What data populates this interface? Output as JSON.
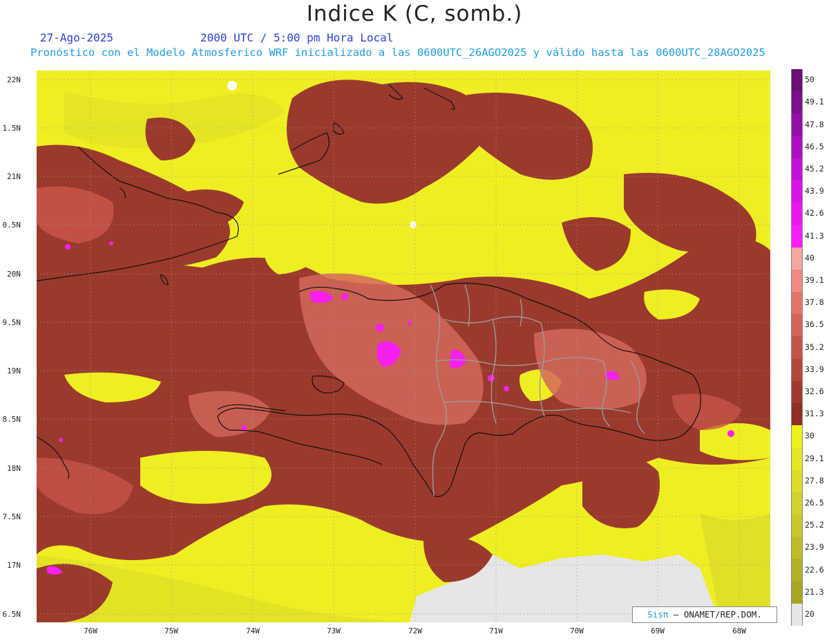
{
  "header": {
    "title": "Indice K (C, somb.)",
    "date": "27-Ago-2025",
    "time": "2000 UTC / 5:00 pm Hora Local",
    "model_info": "Pronóstico con el Modelo Atmosferico WRF inicializado a las 0600UTC_26AGO2025 y válido hasta las  0600UTC_28AGO2025"
  },
  "axes": {
    "lat_labels": [
      "22N",
      "1.5N",
      "21N",
      "0.5N",
      "20N",
      "9.5N",
      "19N",
      "8.5N",
      "18N",
      "7.5N",
      "17N",
      "6.5N"
    ],
    "lon_labels": [
      "76W",
      "75W",
      "74W",
      "73W",
      "72W",
      "71W",
      "70W",
      "69W",
      "68W"
    ]
  },
  "colorbar": {
    "labels": [
      "50",
      "49.1",
      "47.8",
      "46.5",
      "45.2",
      "43.9",
      "42.6",
      "41.3",
      "40",
      "39.1",
      "37.8",
      "36.5",
      "35.2",
      "33.9",
      "32.6",
      "31.3",
      "30",
      "29.1",
      "27.8",
      "26.5",
      "25.2",
      "23.9",
      "22.6",
      "21.3",
      "20"
    ],
    "colors": [
      "#6a0f78",
      "#7d0f8e",
      "#940fa8",
      "#ac10c2",
      "#c312d8",
      "#d915e6",
      "#ea18ef",
      "#f81ef8",
      "#f7a5a0",
      "#f08a82",
      "#e47468",
      "#d66457",
      "#c65447",
      "#b4463a",
      "#a03a2f",
      "#8e3024",
      "#eef21c",
      "#e5e624",
      "#dcdc2a",
      "#d2d22c",
      "#c8c82c",
      "#bdbd2a",
      "#b1b127",
      "#a6a624",
      "#e6e6e6"
    ]
  },
  "map": {
    "land_fill": "#eeee22",
    "sea_gray": "#e6e6e6",
    "magenta": "#f41ff0"
  },
  "credit": {
    "sis": "Sisπ",
    "rest": " – ONAMET/REP.DOM."
  }
}
